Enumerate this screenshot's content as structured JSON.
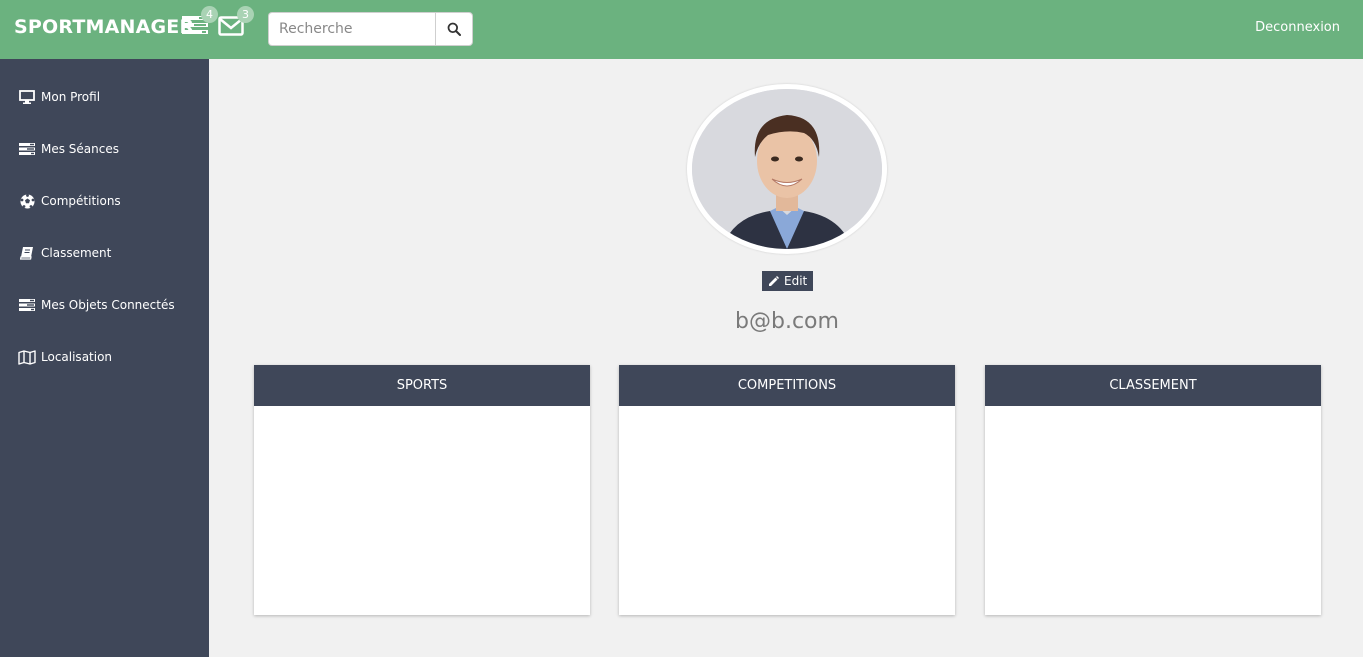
{
  "header": {
    "brand": "SPORTMANAGER",
    "notifications": {
      "icon": "tasks-icon",
      "count": "4"
    },
    "messages": {
      "icon": "envelope-icon",
      "count": "3"
    },
    "search": {
      "placeholder": "Recherche",
      "button_icon": "search-icon"
    },
    "logout_label": "Deconnexion"
  },
  "sidebar": {
    "items": [
      {
        "label": "Mon Profil",
        "icon": "monitor-icon"
      },
      {
        "label": "Mes Séances",
        "icon": "tasks-icon"
      },
      {
        "label": "Compétitions",
        "icon": "soccer-ball-icon"
      },
      {
        "label": "Classement",
        "icon": "book-icon"
      },
      {
        "label": "Mes Objets Connectés",
        "icon": "tasks-icon"
      },
      {
        "label": "Localisation",
        "icon": "map-icon"
      }
    ]
  },
  "profile": {
    "edit_label": "Edit",
    "email": "b@b.com"
  },
  "cards": [
    {
      "title": "SPORTS"
    },
    {
      "title": "COMPETITIONS"
    },
    {
      "title": "CLASSEMENT"
    }
  ],
  "colors": {
    "topbar": "#6bb27f",
    "sidebar": "#3f4759",
    "background": "#f1f1f1",
    "card_header": "#3f4759"
  }
}
